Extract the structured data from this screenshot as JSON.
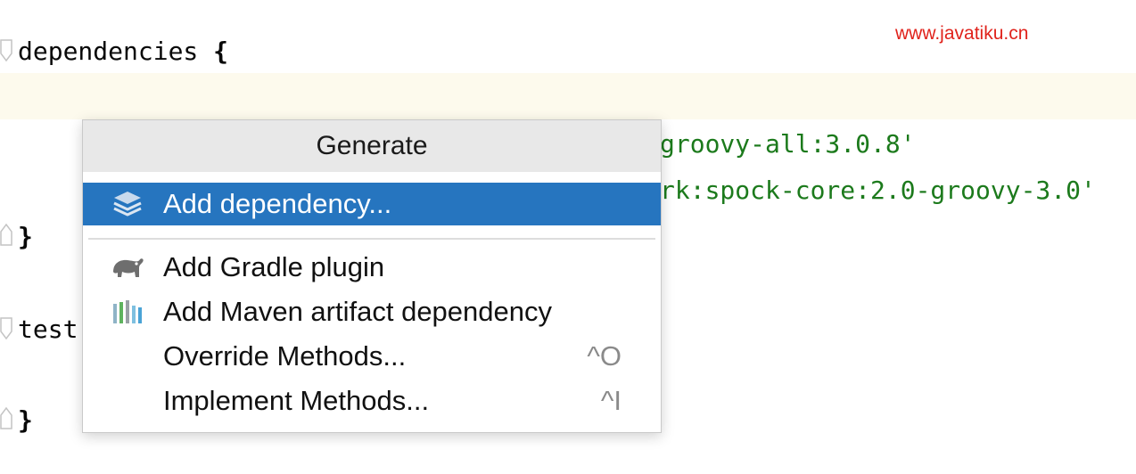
{
  "watermark": "www.javatiku.cn",
  "editor": {
    "line1_keyword": "dependencies",
    "line1_brace": "{",
    "line3_text": "groovy-all:3.0.8'",
    "line4_text": "rk:spock-core:2.0-groovy-3.0'",
    "line5_brace": "}",
    "line7_text": "test",
    "line9_brace": "}"
  },
  "popup": {
    "title": "Generate",
    "items": [
      {
        "label": "Add dependency...",
        "icon": "layers-icon",
        "shortcut": "",
        "selected": true
      },
      {
        "label": "Add Gradle plugin",
        "icon": "gradle-elephant-icon",
        "shortcut": ""
      },
      {
        "label": "Add Maven artifact dependency",
        "icon": "maven-bars-icon",
        "shortcut": ""
      },
      {
        "label": "Override Methods...",
        "icon": "",
        "shortcut": "^O"
      },
      {
        "label": "Implement Methods...",
        "icon": "",
        "shortcut": "^I"
      }
    ]
  },
  "colors": {
    "selection": "#2675bf",
    "string": "#1c7a1c",
    "watermark": "#e0231c",
    "current_line": "#fdfaed"
  }
}
